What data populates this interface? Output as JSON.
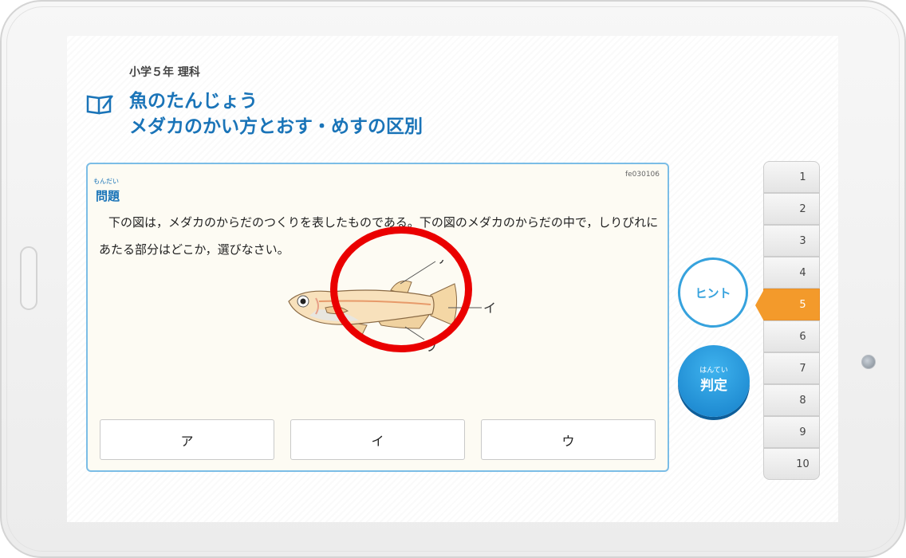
{
  "header": {
    "grade_subject": "小学５年 理科",
    "title_line1": "魚のたんじょう",
    "title_line2": "メダカのかい方とおす・めすの区別"
  },
  "question": {
    "code": "fe030106",
    "label_ruby": "もんだい",
    "label": "問題",
    "text": "下の図は，メダカのからだのつくりを表したものである。下の図のメダカのからだの中で，しりびれにあたる部分はどこか，選びなさい。",
    "figure_labels": [
      "ア",
      "イ",
      "ウ"
    ],
    "choices": [
      "ア",
      "イ",
      "ウ"
    ]
  },
  "buttons": {
    "hint": "ヒント",
    "judge_ruby": "はんてい",
    "judge": "判定"
  },
  "question_tabs": [
    "1",
    "2",
    "3",
    "4",
    "5",
    "6",
    "7",
    "8",
    "9",
    "10"
  ],
  "active_tab": "5",
  "colors": {
    "title_blue": "#1a74b8",
    "panel_border": "#7bbde6",
    "active_tab": "#f39a2b",
    "hint_blue": "#36a2dd",
    "judge_blue": "#157fc9",
    "annotation_red": "#ea0000"
  },
  "icons": [
    "book-pencil-icon"
  ]
}
